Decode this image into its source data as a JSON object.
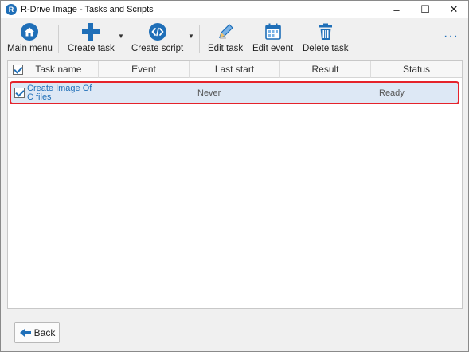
{
  "window": {
    "title": "R-Drive Image - Tasks and Scripts",
    "controls": {
      "minimize": "–",
      "maximize": "☐",
      "close": "✕"
    }
  },
  "toolbar": {
    "main_menu": "Main menu",
    "create_task": "Create task",
    "create_script": "Create script",
    "edit_task": "Edit task",
    "edit_event": "Edit event",
    "delete_task": "Delete task",
    "more": "···",
    "dropdown_arrow": "▼"
  },
  "table": {
    "columns": [
      "Task name",
      "Event",
      "Last start",
      "Result",
      "Status"
    ],
    "header_checked": true,
    "rows": [
      {
        "checked": true,
        "task_name": "Create Image Of C files",
        "event": "",
        "last_start": "Never",
        "result": "",
        "status": "Ready"
      }
    ]
  },
  "footer": {
    "back_label": "Back"
  },
  "colors": {
    "accent": "#1f6fb8",
    "selection": "#dde8f5",
    "highlight_outline": "#e5232b",
    "trash_icon": "#1f6fb8",
    "script_icon": "#1f6fb8"
  },
  "icons": {
    "main_menu": "home-icon",
    "create_task": "plus-icon",
    "create_script": "code-icon",
    "edit_task": "pencil-icon",
    "edit_event": "calendar-icon",
    "delete_task": "trash-icon",
    "back": "arrow-left-icon"
  }
}
